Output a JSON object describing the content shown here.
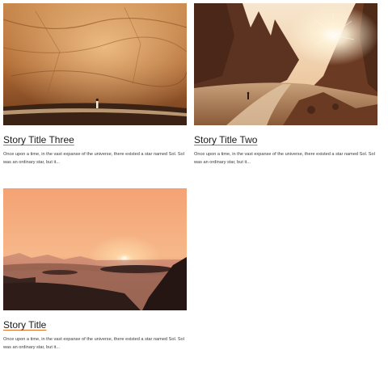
{
  "stories": [
    {
      "title": "Story Title Three",
      "excerpt": "Once upon a time, in the vast expanse of the universe, there existed a star named Sol. Sol was an ordinary star, but it...",
      "image": "canyon-cave-overhang"
    },
    {
      "title": "Story Title Two",
      "excerpt": "Once upon a time, in the vast expanse of the universe, there existed a star named Sol. Sol was an ordinary star, but it...",
      "image": "canyon-path-sunburst"
    },
    {
      "title": "Story Title",
      "excerpt": "Once upon a time, in the vast expanse of the universe, there existed a star named Sol. Sol was an ordinary star, but it...",
      "image": "desert-sunset"
    }
  ],
  "colors": {
    "link_underline": "#e0702a",
    "background": "#ffffff",
    "text": "#1a1a1a"
  }
}
